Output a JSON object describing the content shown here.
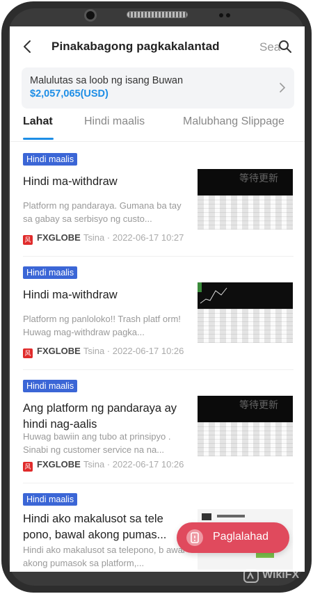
{
  "header": {
    "title": "Pinakabagong pagkakalantad",
    "search_label": "Sea"
  },
  "summary": {
    "label": "Malulutas sa loob ng isang Buwan",
    "value": "$2,057,065(USD)"
  },
  "tabs": [
    {
      "label": "Lahat",
      "active": true
    },
    {
      "label": "Hindi maalis",
      "active": false
    },
    {
      "label": "Malubhang Slippage",
      "active": false
    }
  ],
  "items": [
    {
      "badge": "Hindi maalis",
      "title": "Hindi ma-withdraw",
      "desc": "Platform ng pandaraya. Gumana ba tay sa gabay sa serbisyo ng custo...",
      "brand": "FXGLOBE",
      "meta": "Tsina · 2022-06-17 10:27",
      "thumb_text": "等待更新"
    },
    {
      "badge": "Hindi maalis",
      "title": "Hindi ma-withdraw",
      "desc": "Platform ng panloloko!! Trash platf orm! Huwag mag-withdraw pagka...",
      "brand": "FXGLOBE",
      "meta": "Tsina · 2022-06-17 10:26",
      "thumb_text": ""
    },
    {
      "badge": "Hindi maalis",
      "title": "Ang platform ng pandaraya ay hindi nag-aalis",
      "desc": "Huwag bawiin ang tubo at prinsipyo . Sinabi ng customer service na na...",
      "brand": "FXGLOBE",
      "meta": "Tsina · 2022-06-17 10:26",
      "thumb_text": "等待更新"
    },
    {
      "badge": "Hindi maalis",
      "title": "Hindi ako makalusot sa tele pono, bawal akong pumas...",
      "desc": "Hindi ako makalusot sa telepono, b awal akong pumasok sa platform,...",
      "brand": "",
      "meta": "",
      "thumb_text": ""
    }
  ],
  "fab": {
    "label": "Paglalahad"
  },
  "watermark": "WikiFX",
  "colors": {
    "accent": "#1e8ee6",
    "badge": "#3b66d6",
    "fab": "#e04a5d",
    "brand": "#e02b2b"
  },
  "brand_logo_char": "风"
}
